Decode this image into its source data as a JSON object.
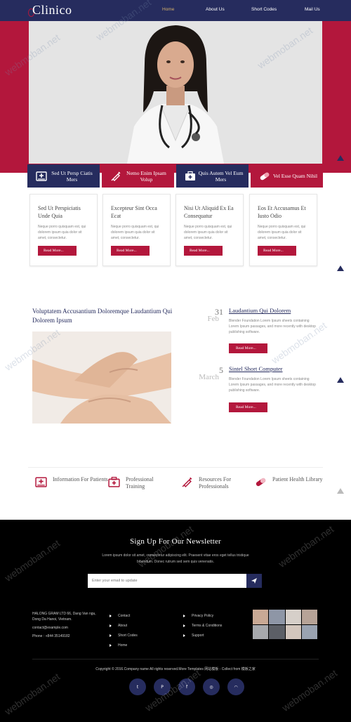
{
  "header": {
    "logo": "Clinico",
    "nav": [
      {
        "label": "Home",
        "active": true
      },
      {
        "label": "About Us"
      },
      {
        "label": "Short Codes"
      },
      {
        "label": "Mail Us"
      }
    ]
  },
  "features": [
    {
      "label": "Sed Ut Persp Ciatis Mers",
      "icon": "hospital-bed-icon"
    },
    {
      "label": "Nemo Enim Ipsam Volup",
      "icon": "syringe-icon"
    },
    {
      "label": "Quis Autem Vel Eum Mers",
      "icon": "medical-kit-icon"
    },
    {
      "label": "Vel Esse Quam Nihil",
      "icon": "pill-icon"
    }
  ],
  "cards": [
    {
      "title": "Sed Ut Perspiciatis Unde Quia",
      "desc": "Neque porro quisquam est, qui dolorem ipsum quia dolor sit amet, consectetur.",
      "button": "Read More..."
    },
    {
      "title": "Excepteur Sint Occa Ecat",
      "desc": "Neque porro quisquam est, qui dolorem ipsum quia dolor sit amet, consectetur.",
      "button": "Read More..."
    },
    {
      "title": "Nisi Ut Aliquid Ex Ea Consequatur",
      "desc": "Neque porro quisquam est, qui dolorem ipsum quia dolor sit amet, consectetur.",
      "button": "Read More..."
    },
    {
      "title": "Eos Et Accusamus Et Iusto Odio",
      "desc": "Neque porro quisquam est, qui dolorem ipsum quia dolor sit amet, consectetur.",
      "button": "Read More..."
    }
  ],
  "about": {
    "title": "Voluptatem Accusantium Doloremque Laudantium Qui Dolorem Ipsum"
  },
  "events": [
    {
      "day": "31",
      "month": "Feb",
      "title": "Laudantium Qui Dolorem",
      "desc": "Blender Foundation Lorem Ipsum sheets containing Lorem Ipsum passages, and more recently with desktop publishing software.",
      "button": "Read More..."
    },
    {
      "day": "5",
      "month": "March",
      "title": "Sintel Short Computer",
      "desc": "Blender Foundation Lorem Ipsum sheets containing Lorem Ipsum passages, and more recently with desktop publishing software.",
      "button": "Read More..."
    }
  ],
  "resources": [
    {
      "label": "Information For Patients",
      "icon": "hospital-bed-icon"
    },
    {
      "label": "Professional Training",
      "icon": "medical-kit-icon"
    },
    {
      "label": "Resources For Professionals",
      "icon": "syringe-icon"
    },
    {
      "label": "Patient Health Library",
      "icon": "pill-icon"
    }
  ],
  "newsletter": {
    "title": "Sign Up For Our Newsletter",
    "desc": "Lorem ipsum dolor sit amet, consectetur adipiscing elit. Praesent vitae eros eget tellus tristique bibendum. Donec rutrum sed sem quis venenatis.",
    "placeholder": "Enter your email to update"
  },
  "footer": {
    "address": [
      "HALONG GRAM LTD 66, Dang Van ngu,",
      "Dong Da Hanoi, Vietnam.",
      "contact@example.com",
      "Phone : +844 35149182"
    ],
    "links_col1": [
      "Contact",
      "About",
      "Short Codes",
      "Home"
    ],
    "links_col2": [
      "Privacy Policy",
      "Terms & Conditions",
      "Support"
    ],
    "copyright": "Copyright © 2016.Company name All rights reserved.More Templates 网站模板 - Collect from 模板之家",
    "socials": [
      {
        "icon": "twitter-icon",
        "glyph": "t"
      },
      {
        "icon": "pinterest-icon",
        "glyph": "P"
      },
      {
        "icon": "facebook-icon",
        "glyph": "f"
      },
      {
        "icon": "dribbble-icon",
        "glyph": "◎"
      },
      {
        "icon": "rss-icon",
        "glyph": "◠"
      }
    ]
  },
  "watermark": "webmoban.net",
  "colors": {
    "navy": "#262c5e",
    "crimson": "#b3173c",
    "gold": "#d5b16a"
  }
}
